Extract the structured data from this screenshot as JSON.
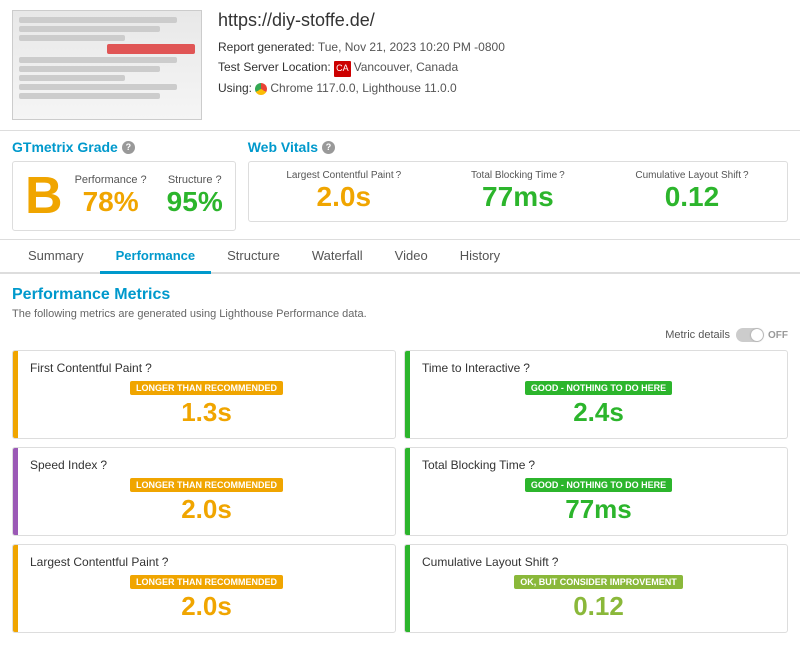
{
  "header": {
    "url": "https://diy-stoffe.de/",
    "report_label": "Report generated:",
    "report_time": "Tue, Nov 21, 2023 10:20 PM -0800",
    "server_label": "Test Server Location:",
    "server_location": "Vancouver, Canada",
    "using_label": "Using:",
    "using_value": "Chrome 117.0.0, Lighthouse 11.0.0"
  },
  "gtmetrix": {
    "title": "GTmetrix Grade",
    "help": "?",
    "grade_letter": "B",
    "performance_label": "Performance",
    "performance_help": "?",
    "performance_value": "78%",
    "structure_label": "Structure",
    "structure_help": "?",
    "structure_value": "95%"
  },
  "web_vitals": {
    "title": "Web Vitals",
    "help": "?",
    "items": [
      {
        "label": "Largest Contentful Paint",
        "help": "?",
        "value": "2.0s",
        "color": "orange"
      },
      {
        "label": "Total Blocking Time",
        "help": "?",
        "value": "77ms",
        "color": "green"
      },
      {
        "label": "Cumulative Layout Shift",
        "help": "?",
        "value": "0.12",
        "color": "green"
      }
    ]
  },
  "tabs": [
    {
      "label": "Summary",
      "active": false
    },
    {
      "label": "Performance",
      "active": true
    },
    {
      "label": "Structure",
      "active": false
    },
    {
      "label": "Waterfall",
      "active": false
    },
    {
      "label": "Video",
      "active": false
    },
    {
      "label": "History",
      "active": false
    }
  ],
  "performance": {
    "heading": "Performance Metrics",
    "subtext": "The following metrics are generated using Lighthouse Performance data.",
    "metric_details_label": "Metric details",
    "toggle_off_label": "OFF",
    "metrics": [
      {
        "name": "First Contentful Paint",
        "help": "?",
        "badge": "Longer than recommended",
        "badge_type": "orange",
        "value": "1.3s",
        "value_color": "orange",
        "bar_color": "orange"
      },
      {
        "name": "Time to Interactive",
        "help": "?",
        "badge": "Good - Nothing to do here",
        "badge_type": "green",
        "value": "2.4s",
        "value_color": "green",
        "bar_color": "green"
      },
      {
        "name": "Speed Index",
        "help": "?",
        "badge": "Longer than recommended",
        "badge_type": "orange",
        "value": "2.0s",
        "value_color": "orange",
        "bar_color": "purple"
      },
      {
        "name": "Total Blocking Time",
        "help": "?",
        "badge": "Good - Nothing to do here",
        "badge_type": "green",
        "value": "77ms",
        "value_color": "green",
        "bar_color": "green"
      },
      {
        "name": "Largest Contentful Paint",
        "help": "?",
        "badge": "Longer than recommended",
        "badge_type": "orange",
        "value": "2.0s",
        "value_color": "orange",
        "bar_color": "orange"
      },
      {
        "name": "Cumulative Layout Shift",
        "help": "?",
        "badge": "OK, but consider improvement",
        "badge_type": "yellow-green",
        "value": "0.12",
        "value_color": "yellow-green",
        "bar_color": "green"
      }
    ]
  }
}
